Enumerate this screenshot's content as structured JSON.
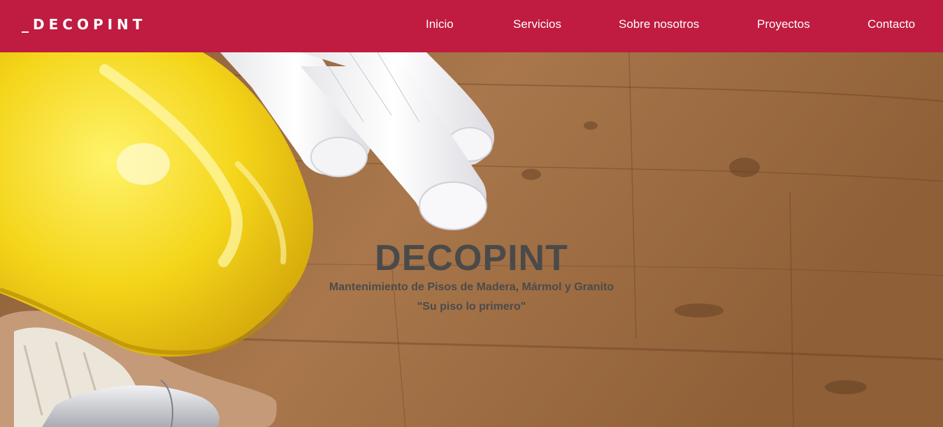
{
  "header": {
    "logo": "_DECOPINT",
    "brand_color": "#c01b40",
    "nav": [
      {
        "label": "Inicio"
      },
      {
        "label": "Servicios"
      },
      {
        "label": "Sobre nosotros"
      },
      {
        "label": "Proyectos"
      },
      {
        "label": "Contacto"
      }
    ]
  },
  "hero": {
    "title": "DECOPINT",
    "subtitle": "Mantenimiento de Pisos de Madera, Mármol y Granito",
    "tagline": "\"Su piso lo primero\"",
    "background_image": "wooden-floor-with-yellow-hard-hat-blueprints-gloves-hammer"
  }
}
